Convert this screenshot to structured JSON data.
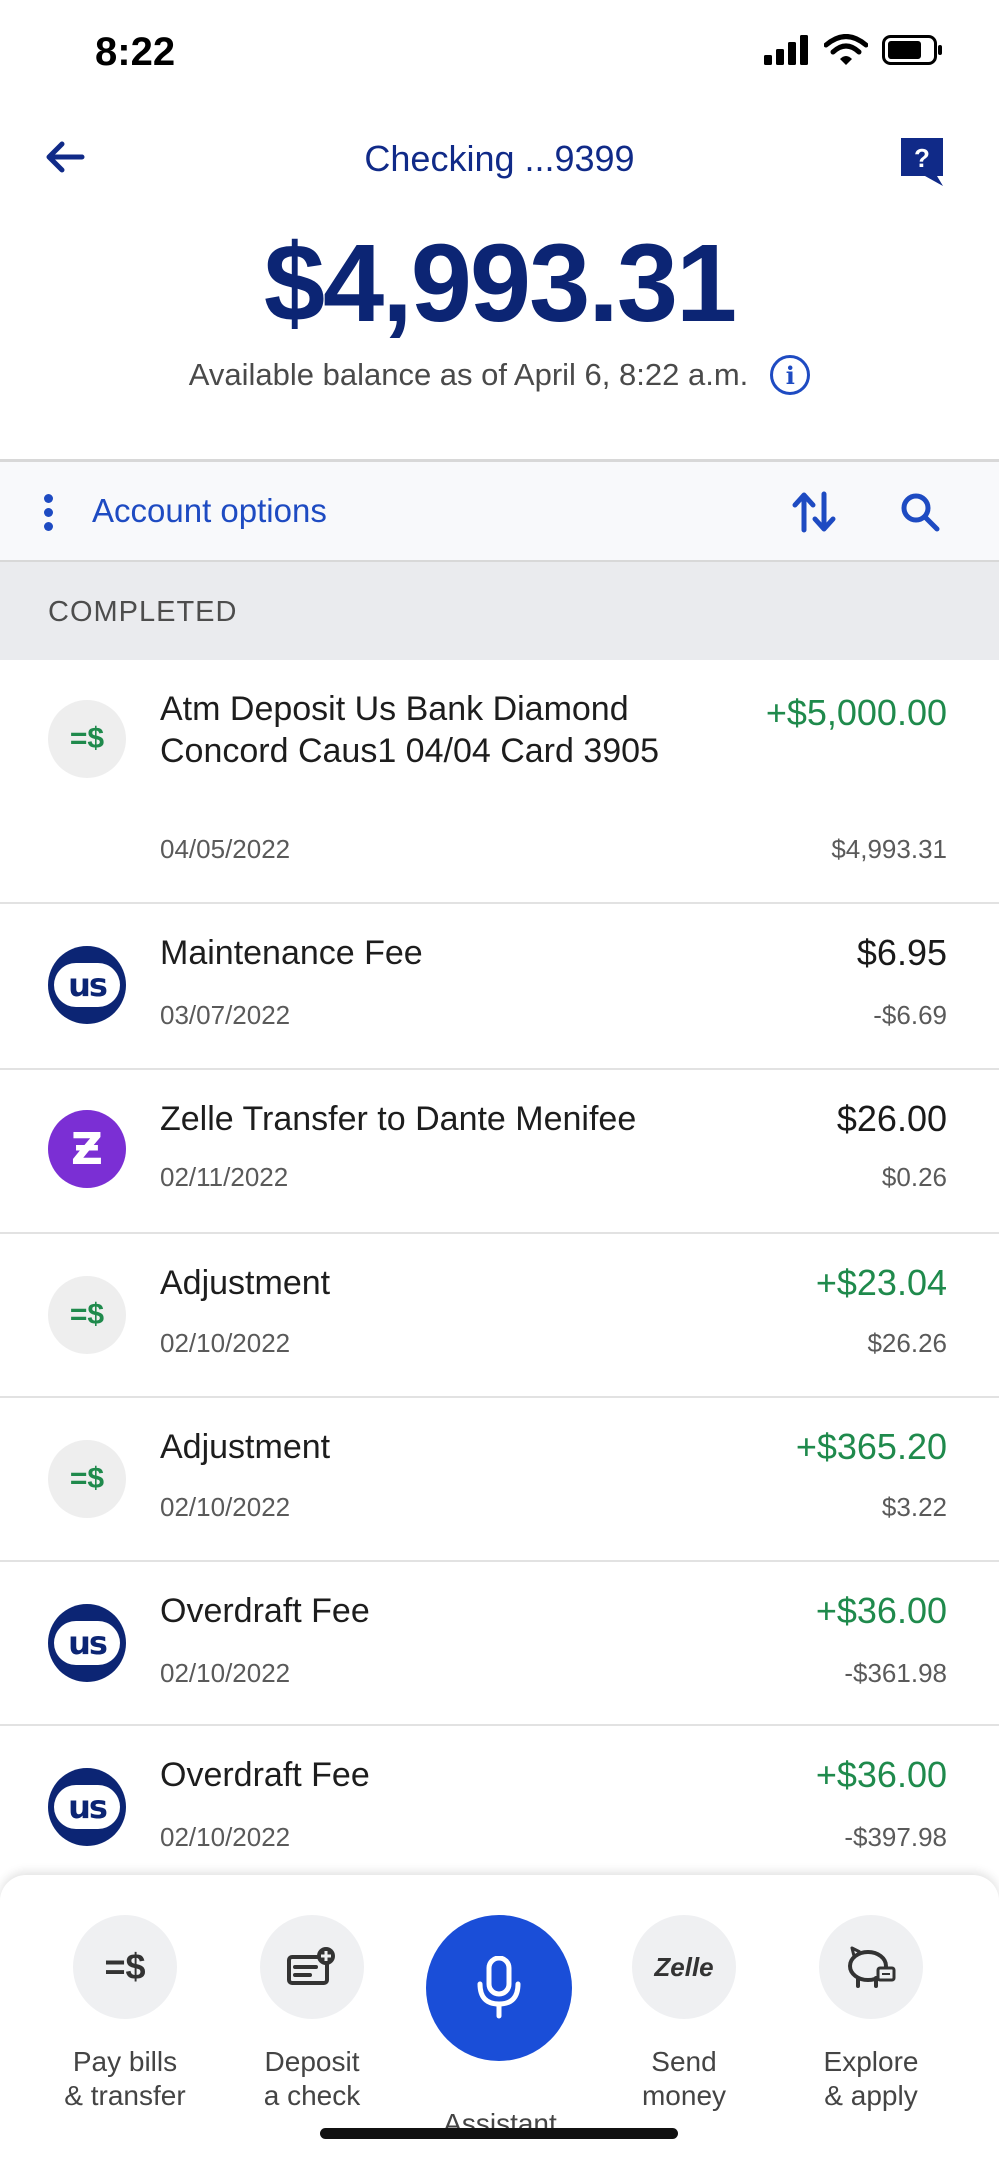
{
  "status_bar": {
    "time": "8:22"
  },
  "header": {
    "account_title": "Checking ...9399",
    "balance": "$4,993.31",
    "available_text": "Available balance as of April 6, 8:22 a.m."
  },
  "options": {
    "label": "Account options"
  },
  "section": {
    "title": "COMPLETED"
  },
  "transactions": [
    {
      "icon": "deposit-icon",
      "description": "Atm Deposit Us Bank Diamond Concord Caus1 04/04 Card 3905",
      "date": "04/05/2022",
      "amount": "+$5,000.00",
      "running_balance": "$4,993.31",
      "positive": true
    },
    {
      "icon": "us-bank-logo-icon",
      "description": "Maintenance Fee",
      "date": "03/07/2022",
      "amount": "$6.95",
      "running_balance": "-$6.69",
      "positive": false
    },
    {
      "icon": "zelle-icon",
      "description": "Zelle Transfer to Dante Menifee",
      "date": "02/11/2022",
      "amount": "$26.00",
      "running_balance": "$0.26",
      "positive": false
    },
    {
      "icon": "deposit-icon",
      "description": "Adjustment",
      "date": "02/10/2022",
      "amount": "+$23.04",
      "running_balance": "$26.26",
      "positive": true
    },
    {
      "icon": "deposit-icon",
      "description": "Adjustment",
      "date": "02/10/2022",
      "amount": "+$365.20",
      "running_balance": "$3.22",
      "positive": true
    },
    {
      "icon": "us-bank-logo-icon",
      "description": "Overdraft Fee",
      "date": "02/10/2022",
      "amount": "+$36.00",
      "running_balance": "-$361.98",
      "positive": true
    },
    {
      "icon": "us-bank-logo-icon",
      "description": "Overdraft Fee",
      "date": "02/10/2022",
      "amount": "+$36.00",
      "running_balance": "-$397.98",
      "positive": true
    }
  ],
  "bottom_nav": {
    "pay": "Pay bills\n& transfer",
    "deposit": "Deposit\na check",
    "assistant": "Assistant",
    "send": "Send\nmoney",
    "explore": "Explore\n& apply",
    "zelle_logo_text": "Zelle"
  },
  "colors": {
    "brand_navy": "#0c2574",
    "link_blue": "#1e4bc2",
    "positive_green": "#1f8a4c",
    "zelle_purple": "#7b2fd4",
    "assistant_blue": "#1a4ed8"
  }
}
